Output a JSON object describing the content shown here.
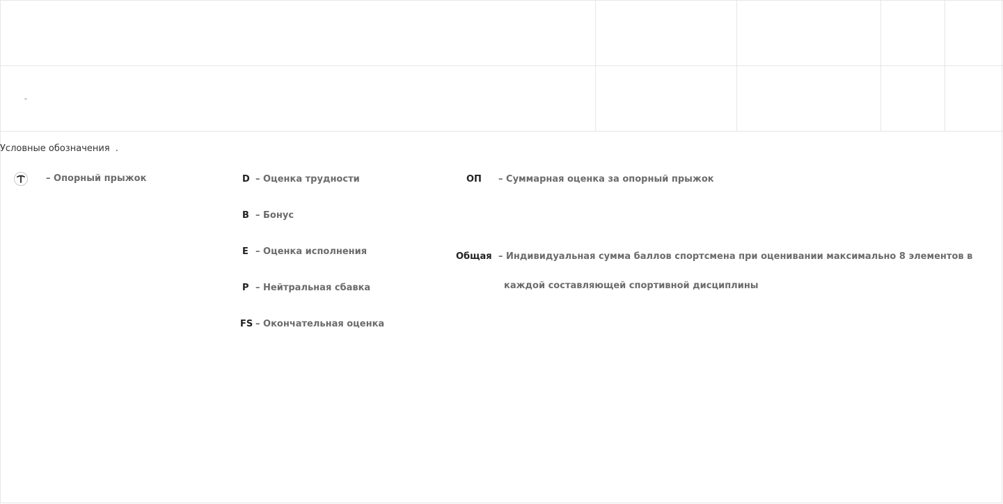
{
  "table": {
    "rows": [
      [
        "",
        "",
        "",
        "",
        ""
      ],
      [
        "-",
        "",
        "",
        "",
        ""
      ]
    ]
  },
  "legend": {
    "title": "Условные обозначения  .",
    "vault_icon": "vault-icon",
    "vault_desc": "– Опорный прыжок",
    "items": [
      {
        "abbr": "D",
        "desc": "– Оценка трудности"
      },
      {
        "abbr": "B",
        "desc": "– Бонус"
      },
      {
        "abbr": "E",
        "desc": "– Оценка исполнения"
      },
      {
        "abbr": "P",
        "desc": "– Нейтральная сбавка"
      },
      {
        "abbr": "FS",
        "desc": "– Окончательная оценка"
      }
    ],
    "op": {
      "abbr": "ОП",
      "desc": "– Суммарная оценка за опорный прыжок"
    },
    "total": {
      "abbr": "Общая",
      "desc_line1": "– Индивидуальная сумма баллов спортсмена при оценивании максимально 8 элементов в",
      "desc_line2": "каждой составляющей спортивной дисциплины"
    }
  }
}
